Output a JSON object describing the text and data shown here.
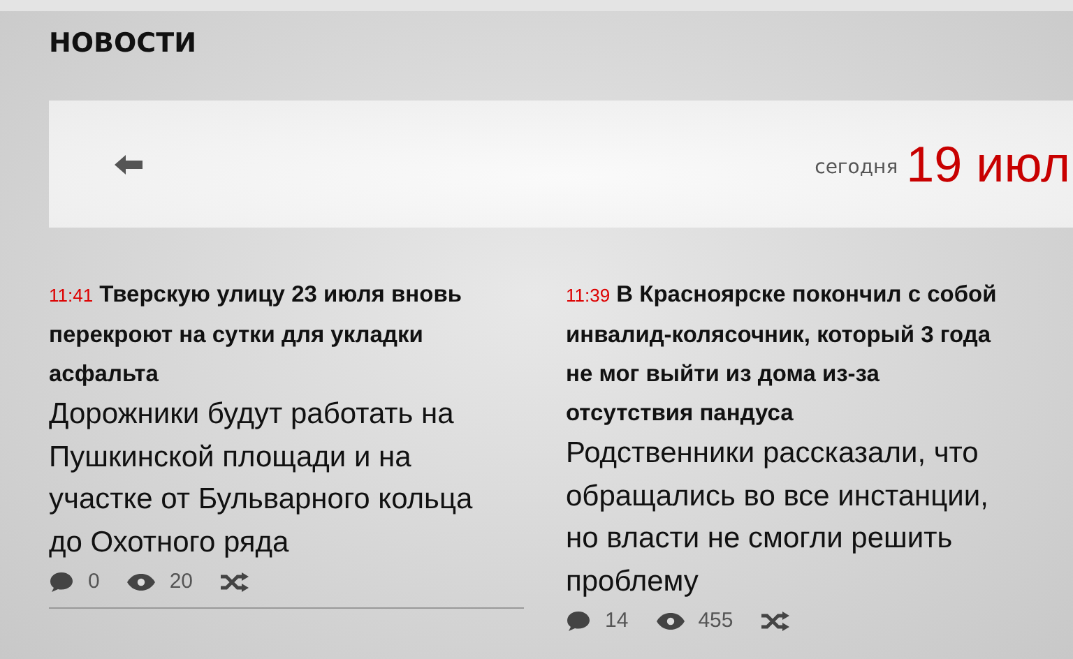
{
  "section_title": "НОВОСТИ",
  "date_bar": {
    "today_label": "сегодня",
    "date": "19 июл"
  },
  "news": [
    {
      "time": "11:41",
      "headline": "Тверскую улицу 23 июля вновь перекроют на сутки для укладки асфальта",
      "summary": "Дорожники будут работать на Пушкинской площади и на участке от Бульварного кольца до Охотного ряда",
      "comments": "0",
      "views": "20"
    },
    {
      "time": "11:39",
      "headline": "В Красноярске покончил с собой инвалид-колясочник, который 3 года не мог выйти из дома из-за отсутствия пандуса",
      "summary": "Родственники рассказали, что обращались во все инстанции, но власти не смогли решить проблему",
      "comments": "14",
      "views": "455"
    }
  ]
}
